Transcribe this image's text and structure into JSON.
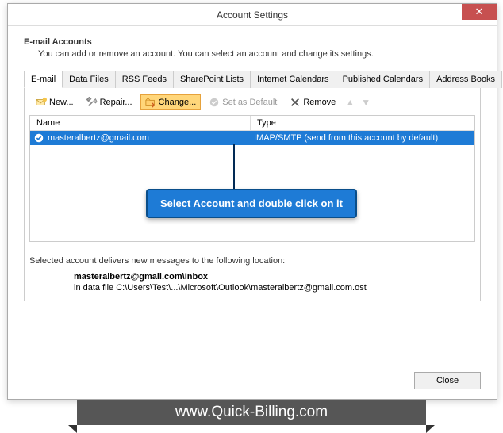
{
  "window": {
    "title": "Account Settings"
  },
  "header": {
    "title": "E-mail Accounts",
    "desc": "You can add or remove an account. You can select an account and change its settings."
  },
  "tabs": [
    "E-mail",
    "Data Files",
    "RSS Feeds",
    "SharePoint Lists",
    "Internet Calendars",
    "Published Calendars",
    "Address Books"
  ],
  "toolbar": {
    "new": "New...",
    "repair": "Repair...",
    "change": "Change...",
    "setdefault": "Set as Default",
    "remove": "Remove"
  },
  "list": {
    "cols": {
      "name": "Name",
      "type": "Type"
    },
    "rows": [
      {
        "name": "masteralbertz@gmail.com",
        "type": "IMAP/SMTP (send from this account by default)"
      }
    ]
  },
  "callout": "Select Account and double click on it",
  "location": {
    "intro": "Selected account delivers new messages to the following location:",
    "bold": "masteralbertz@gmail.com\\Inbox",
    "path": "in data file C:\\Users\\Test\\...\\Microsoft\\Outlook\\masteralbertz@gmail.com.ost"
  },
  "footer": {
    "close": "Close"
  },
  "banner": "www.Quick-Billing.com"
}
